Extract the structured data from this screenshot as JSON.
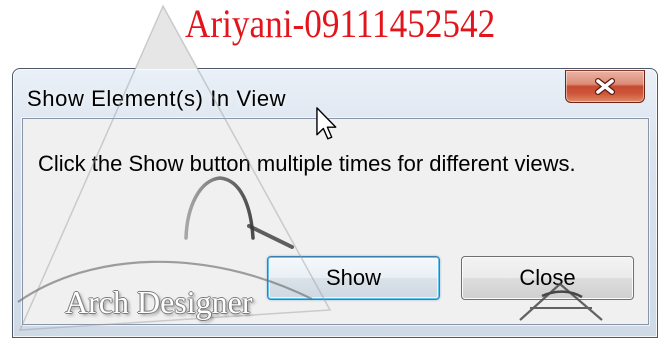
{
  "watermark": {
    "caption": "Ariyani-09111452542",
    "logo_text": "Arch Designer"
  },
  "window": {
    "title": "Show Element(s) In View",
    "close_icon": "close-icon"
  },
  "dialog": {
    "message": "Click the Show button multiple times for different views.",
    "buttons": [
      {
        "label": "Show",
        "focused": true
      },
      {
        "label": "Close",
        "focused": false
      }
    ]
  },
  "cursor": {
    "icon": "arrow-pointer-icon"
  },
  "colors": {
    "caption_red": "#e3141c",
    "client_background": "#f0f0f0",
    "close_button_red": "#c54a31",
    "focus_blue": "#3c7fb1"
  }
}
